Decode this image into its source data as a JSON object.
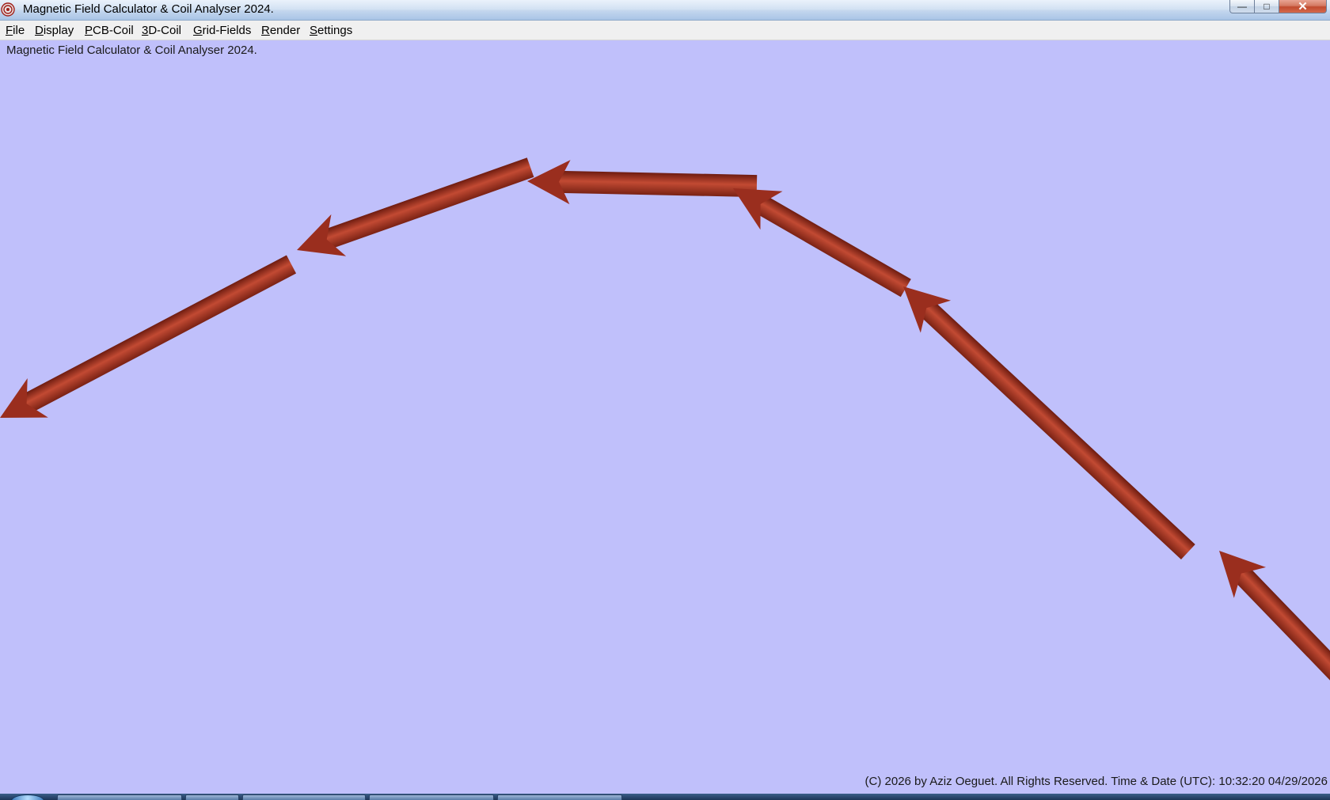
{
  "window": {
    "title": "Magnetic Field Calculator & Coil Analyser 2024.",
    "icon": "coil-app-icon",
    "minimize_glyph": "—",
    "maximize_glyph": "□",
    "close_glyph": "✕"
  },
  "menu": {
    "items": [
      {
        "accel": "F",
        "rest": "ile",
        "name": "menu-file"
      },
      {
        "accel": "D",
        "rest": "isplay",
        "name": "menu-display"
      },
      {
        "accel": "P",
        "rest": "CB-Coil",
        "name": "menu-pcb-coil"
      },
      {
        "accel": "3",
        "rest": "D-Coil",
        "name": "menu-3d-coil"
      },
      {
        "accel": "G",
        "rest": "rid-Fields",
        "name": "menu-grid-fields"
      },
      {
        "accel": "R",
        "rest": "ender",
        "name": "menu-render"
      },
      {
        "accel": "S",
        "rest": "ettings",
        "name": "menu-settings"
      }
    ]
  },
  "canvas": {
    "title": "Magnetic Field Calculator & Coil Analyser 2024.",
    "background": "#c0c0fb",
    "arrow_color": "#9a2e1e",
    "arrow_highlight": "#c24a33",
    "arrow_shadow": "#6e1c10",
    "copyright": "(C) 2026  by Aziz Oeguet. All Rights Reserved.  Time & Date (UTC): 10:32:20  04/29/2026"
  },
  "taskbar": {
    "icon": "windows-start-orb"
  }
}
